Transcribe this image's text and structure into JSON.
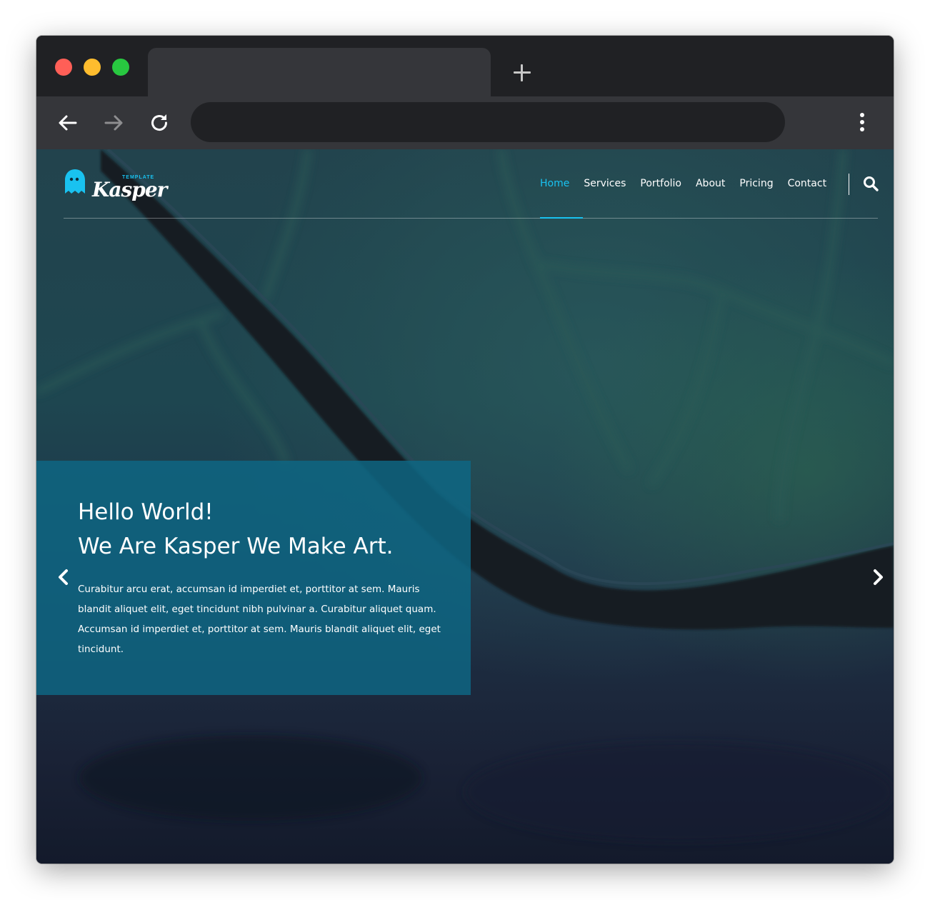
{
  "browser": {
    "tab_title": "",
    "address": "",
    "icons": {
      "back": "arrow-left-icon",
      "forward": "arrow-right-icon",
      "reload": "reload-icon",
      "menu": "vertical-dots-icon",
      "new_tab": "plus-icon"
    }
  },
  "site": {
    "logo": {
      "tag": "TEMPLATE",
      "name": "Kasper"
    },
    "nav": {
      "items": [
        {
          "label": "Home",
          "active": true
        },
        {
          "label": "Services",
          "active": false
        },
        {
          "label": "Portfolio",
          "active": false
        },
        {
          "label": "About",
          "active": false
        },
        {
          "label": "Pricing",
          "active": false
        },
        {
          "label": "Contact",
          "active": false
        }
      ]
    },
    "hero": {
      "title_line1": "Hello World!",
      "title_line2": "We Are Kasper We Make Art.",
      "body": "Curabitur arcu erat, accumsan id imperdiet et, porttitor at sem. Mauris blandit aliquet elit, eget tincidunt nibh pulvinar a. Curabitur aliquet quam. Accumsan id imperdiet et, porttitor at sem. Mauris blandit aliquet elit, eget tincidunt."
    }
  },
  "colors": {
    "accent": "#19c2f0",
    "hero_box": "#0e6885",
    "chrome_dark": "#202124",
    "chrome_toolbar": "#35363a"
  }
}
